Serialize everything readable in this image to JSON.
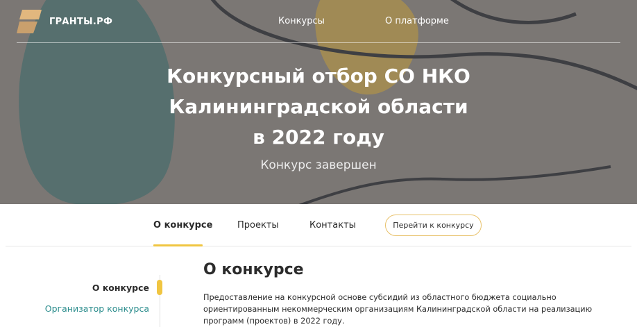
{
  "header": {
    "logo_text": "ГРАНТЫ.РФ",
    "nav": [
      {
        "label": "Конкурсы"
      },
      {
        "label": "О платформе"
      }
    ]
  },
  "hero": {
    "title_lines": [
      "Конкурсный отбор СО НКО",
      "Калининградской области",
      "в 2022 году"
    ],
    "status": "Конкурс завершен"
  },
  "subnav": {
    "tabs": [
      {
        "label": "О конкурсе",
        "active": true
      },
      {
        "label": "Проекты"
      },
      {
        "label": "Контакты"
      }
    ],
    "goto_button": "Перейти к конкурсу"
  },
  "sidebar": {
    "items": [
      {
        "label": "О конкурсе",
        "active": true
      },
      {
        "label": "Организатор конкурса"
      }
    ]
  },
  "content": {
    "title": "О конкурсе",
    "text": "Предоставление на конкурсной основе субсидий из областного бюджета социально ориентированным некоммерческим организациям Калининградской области на реализацию программ (проектов) в 2022 году."
  },
  "colors": {
    "accent": "#f0c541",
    "link": "#2a8c8c",
    "hero_bg": "#7b7774"
  }
}
